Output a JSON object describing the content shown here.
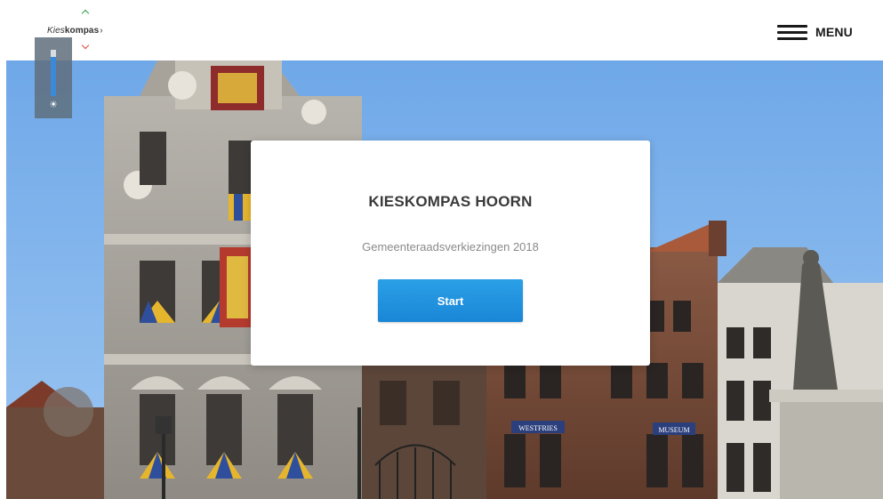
{
  "header": {
    "logo_prefix": "Kies",
    "logo_suffix": "kompas",
    "logo_chevron": "›",
    "menu_label": "MENU"
  },
  "brightness": {
    "level": 0.85,
    "icon": "sun-icon"
  },
  "card": {
    "title": "KIESKOMPAS HOORN",
    "subtitle": "Gemeenteraadsverkiezingen 2018",
    "start_label": "Start"
  },
  "hero": {
    "building_signs": [
      "WESTFRIES",
      "MUSEUM"
    ]
  },
  "colors": {
    "accent_blue": "#1e90dc",
    "logo_up_green": "#2f9e4c",
    "logo_down_red": "#e04a3c",
    "sky": "#7fb4ec"
  }
}
